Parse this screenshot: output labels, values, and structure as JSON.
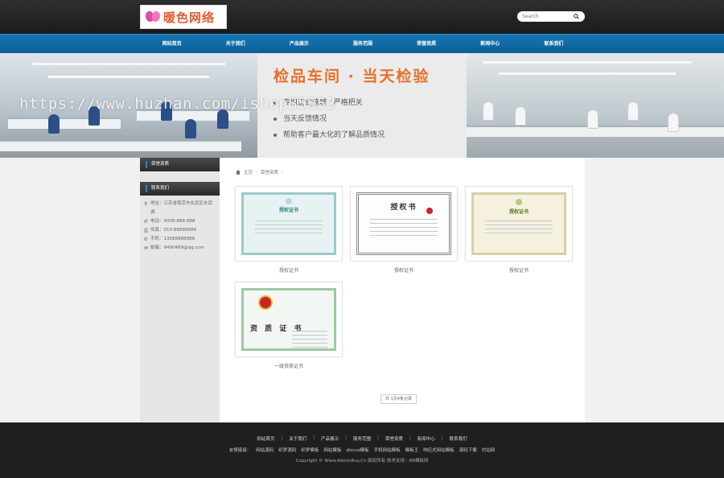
{
  "header": {
    "logo_text": "暖色网络",
    "search_placeholder": "Search"
  },
  "nav": {
    "items": [
      "网站首页",
      "关于我们",
      "产品展示",
      "服务范围",
      "荣誉资质",
      "新闻中心",
      "联系我们"
    ]
  },
  "banner": {
    "title": "检品车间 · 当天检验",
    "bullets": [
      "专用正式管理 · 严格把关",
      "当天反馈情况",
      "帮助客户最大化的了解品质情况"
    ],
    "watermark": "https://www.huzhan.com/ishop35953"
  },
  "sidebar": {
    "section1_title": "荣誉资质",
    "section2_title": "联系我们",
    "contact": [
      {
        "icon": "map-marker-icon",
        "glyph": "⚲",
        "text": "地址：江苏省南京市玄武区玄武湖"
      },
      {
        "icon": "phone-icon",
        "glyph": "✆",
        "text": "电话：4008-888-888"
      },
      {
        "icon": "fax-icon",
        "glyph": "⎙",
        "text": "传真：010-88888888"
      },
      {
        "icon": "mobile-icon",
        "glyph": "✆",
        "text": "手机：13588888888"
      },
      {
        "icon": "mail-icon",
        "glyph": "✉",
        "text": "邮箱：9490489@qq.com"
      }
    ]
  },
  "main": {
    "breadcrumb": [
      "主页",
      "荣誉资质"
    ],
    "cards": [
      {
        "caption": "授权证书",
        "cert_title": "授权证书"
      },
      {
        "caption": "授权证书",
        "cert_title": "授权书"
      },
      {
        "caption": "授权证书",
        "cert_title": "授权证书"
      },
      {
        "caption": "一级资质证书",
        "cert_title": "资 质 证 书"
      }
    ],
    "pager": "共 1页4条记录"
  },
  "footer": {
    "nav": [
      "网站首页",
      "关于我们",
      "产品展示",
      "服务范围",
      "荣誉资质",
      "新闻中心",
      "联系我们"
    ],
    "friend_label": "友情链接：",
    "friend_links": [
      "网站源码",
      "织梦源码",
      "织梦模板",
      "网站模板",
      "discuz模板",
      "手机网站模板",
      "模板王",
      "响应式网站模板",
      "源码下载",
      "仿站网"
    ],
    "copyright": "Copyright © Www.AdminBuy.Cn 版权所有 技术支持：AB模板网"
  }
}
